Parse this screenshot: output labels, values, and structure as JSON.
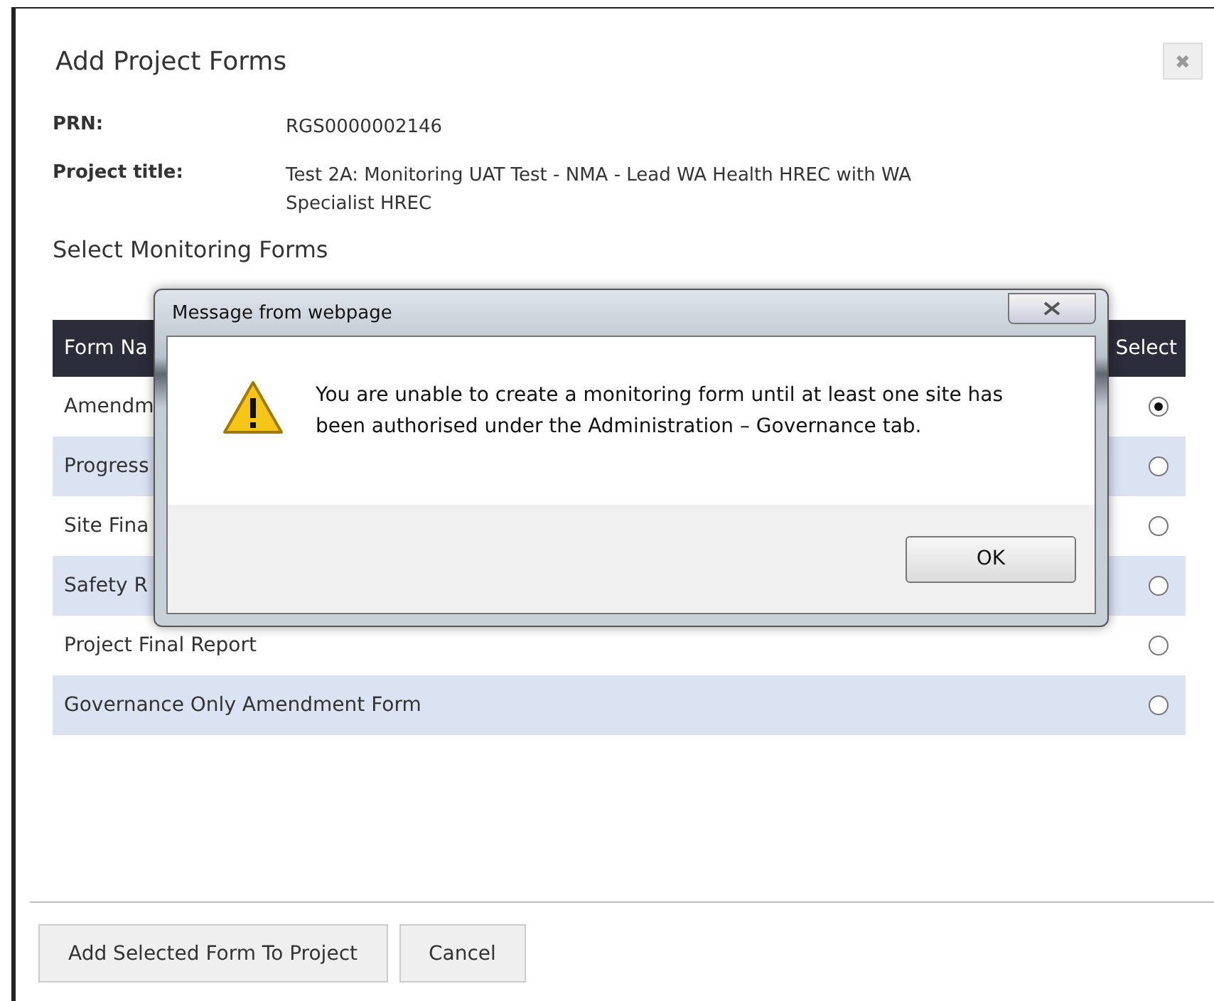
{
  "dialog": {
    "title": "Add Project Forms",
    "close": "✖",
    "fields": [
      {
        "label": "PRN:",
        "value": "RGS0000002146"
      },
      {
        "label": "Project title:",
        "value": "Test 2A: Monitoring UAT Test - NMA - Lead WA Health  HREC with WA Specialist HREC"
      }
    ],
    "section_title": "Select Monitoring Forms",
    "table": {
      "columns": [
        "Form Na",
        "Select"
      ],
      "rows": [
        {
          "name": "Amendm",
          "selected": true
        },
        {
          "name": "Progress",
          "selected": false
        },
        {
          "name": "Site Fina",
          "selected": false
        },
        {
          "name": "Safety R",
          "selected": false
        },
        {
          "name": "Project Final Report",
          "selected": false
        },
        {
          "name": "Governance Only Amendment Form",
          "selected": false
        }
      ]
    },
    "buttons": [
      "Add Selected Form To Project",
      "Cancel"
    ]
  },
  "message_box": {
    "title": "Message from webpage",
    "text": "You are unable to create a monitoring form until at least one site has been authorised under the Administration – Governance tab.",
    "button": "OK"
  }
}
